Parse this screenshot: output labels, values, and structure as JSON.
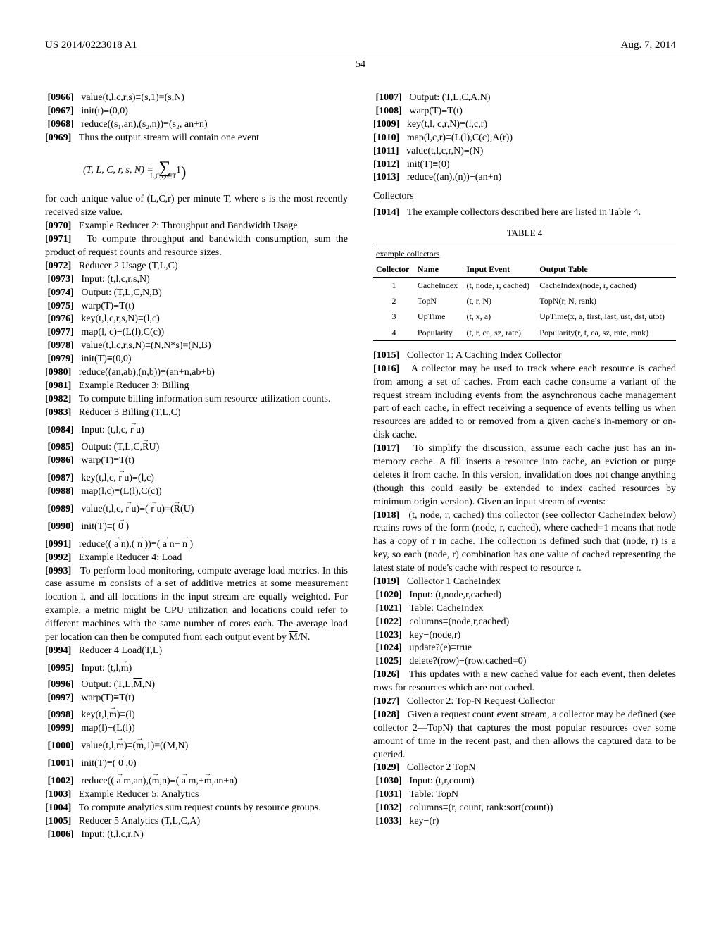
{
  "header": {
    "pub": "US 2014/0223018 A1",
    "date": "Aug. 7, 2014",
    "pagenum": "54"
  },
  "left": {
    "p0966": "value(t,l,c,r,s)≡(s,1)=(s,N)",
    "p0967": "init(t)≡(0,0)",
    "p0968": "reduce((s₁,an),(s₂,n))≡(s₂, an+n)",
    "p0969": "Thus the output stream will contain one event",
    "eq1_lhs": "(T, L, C, r, s, N) =",
    "eq1_rhs_sub": "L,C,r,t∈T",
    "p_for_each": "for each unique value of (L,C,r) per minute T, where s is the most recently received size value.",
    "p0970": "Example Reducer 2: Throughput and Bandwidth Usage",
    "p0971": "To compute throughput and bandwidth consumption, sum the product of request counts and resource sizes.",
    "p0972": "Reducer 2 Usage (T,L,C)",
    "p0973": "Input: (t,l,c,r,s,N)",
    "p0974": "Output: (T,L,C,N,B)",
    "p0975": "warp(T)≡T(t)",
    "p0976": "key(t,l,c,r,s,N)≡(l,c)",
    "p0977": "map(l, c)≡(L(l),C(c))",
    "p0978": "value(t,l,c,r,s,N)≡(N,N*s)=(N,B)",
    "p0979": "init(T)≡(0,0)",
    "p0980": "reduce((an,ab),(n,b))≡(an+n,ab+b)",
    "p0981": "Example Reducer 3: Billing",
    "p0982": "To compute billing information sum resource utilization counts.",
    "p0983": "Reducer 3 Billing (T,L,C)",
    "p0984_a": "Input: (t,l,c,",
    "p0984_b": "u)",
    "p0985_a": "Output: (T,L,C,",
    "p0985_b": "U)",
    "p0986": "warp(T)≡T(t)",
    "p0987_a": "key(t,l,c,",
    "p0987_b": "u)≡(l,c)",
    "p0988": "map(l,c)≡(L(l),C(c))",
    "p0989_a": "value(t,l,c,",
    "p0989_b": "u)≡(",
    "p0989_c": "u)=(",
    "p0989_d": "(U)",
    "p0990_a": "init(T)≡(",
    "p0990_b": ")",
    "p0991_a": "reduce((",
    "p0991_b": "n),(",
    "p0991_c": "))≡(",
    "p0991_d": "n+",
    "p0991_e": ")",
    "p0992": "Example Reducer 4: Load",
    "p0993_a": "To perform load monitoring, compute average load metrics. In this case assume ",
    "p0993_b": " consists of a set of additive metrics at some measurement location l, and all locations in the input stream are equally weighted. For example, a metric might be CPU utilization and locations could refer to different machines with the same number of cores each. The average load per location can then be computed from each output event by ",
    "p0993_c": "/N.",
    "p0994": "Reducer 4 Load(T,L)",
    "p0995_a": "Input: (t,l,",
    "p0995_b": ")",
    "p0996_a": "Output: (T,L,",
    "p0996_b": ",N)",
    "p0997": "warp(T)≡T(t)",
    "p0998_a": "key(t,l,",
    "p0998_b": ")≡(l)",
    "p0999": "map(l)≡(L(l))",
    "p1000_a": "value(t,l,",
    "p1000_b": ")≡(",
    "p1000_c": ",1)=((",
    "p1000_d": ",N)",
    "p1001_a": "init(T)≡(",
    "p1001_b": ",0)",
    "p1002_a": "reduce((",
    "p1002_b": "m,an),(",
    "p1002_c": ",n)≡(",
    "p1002_d": "m,+",
    "p1002_e": ",an+n)",
    "p1003": "Example Reducer 5: Analytics",
    "p1004": "To compute analytics sum request counts by resource groups.",
    "p1005": "Reducer 5 Analytics (T,L,C,A)",
    "p1006": "Input: (t,l,c,r,N)"
  },
  "right": {
    "p1007": "Output: (T,L,C,A,N)",
    "p1008": "warp(T)≡T(t)",
    "p1009": "key(t,l, c,r,N)≡(l,c,r)",
    "p1010": "map(l,c,r)≡(L(l),C(c),A(r))",
    "p1011": "value(t,l,c,r,N)≡(N)",
    "p1012": "init(T)≡(0)",
    "p1013": "reduce((an),(n))≡(an+n)",
    "collectors_head": "Collectors",
    "p1014": "The example collectors described here are listed in Table 4.",
    "table4": {
      "caption": "TABLE 4",
      "subcap": "example collectors",
      "headers": [
        "Collector",
        "Name",
        "Input Event",
        "Output Table"
      ],
      "rows": [
        [
          "1",
          "CacheIndex",
          "(t, node, r, cached)",
          "CacheIndex(node, r, cached)"
        ],
        [
          "2",
          "TopN",
          "(t, r, N)",
          "TopN(r, N, rank)"
        ],
        [
          "3",
          "UpTime",
          "(t, x, a)",
          "UpTime(x, a, first, last, ust, dst, utot)"
        ],
        [
          "4",
          "Popularity",
          "(t, r, ca, sz, rate)",
          "Popularity(r, t, ca, sz, rate, rank)"
        ]
      ]
    },
    "p1015": "Collector 1: A Caching Index Collector",
    "p1016": "A collector may be used to track where each resource is cached from among a set of caches. From each cache consume a variant of the request stream including events from the asynchronous cache management part of each cache, in effect receiving a sequence of events telling us when resources are added to or removed from a given cache's in-memory or on-disk cache.",
    "p1017": "To simplify the discussion, assume each cache just has an in-memory cache. A fill inserts a resource into cache, an eviction or purge deletes it from cache. In this version, invalidation does not change anything (though this could easily be extended to index cached resources by minimum origin version). Given an input stream of events:",
    "p1018": "(t, node, r, cached) this collector (see collector CacheIndex below) retains rows of the form (node, r, cached), where cached=1 means that node has a copy of r in cache. The collection is defined such that (node, r) is a key, so each (node, r) combination has one value of cached representing the latest state of node's cache with respect to resource r.",
    "p1019": "Collector 1 CacheIndex",
    "p1020": "Input: (t,node,r,cached)",
    "p1021": "Table: CacheIndex",
    "p1022": "columns≡(node,r,cached)",
    "p1023": "key≡(node,r)",
    "p1024": "update?(e)≡true",
    "p1025": "delete?(row)≡(row.cached=0)",
    "p1026": "This updates with a new cached value for each event, then deletes rows for resources which are not cached.",
    "p1027": "Collector 2: Top-N Request Collector",
    "p1028": "Given a request count event stream, a collector may be defined (see collector 2—TopN) that captures the most popular resources over some amount of time in the recent past, and then allows the captured data to be queried.",
    "p1029": "Collector 2 TopN",
    "p1030": "Input: (t,r,count)",
    "p1031": "Table: TopN",
    "p1032": "columns≡(r, count, rank:sort(count))",
    "p1033": "key≡(r)"
  }
}
